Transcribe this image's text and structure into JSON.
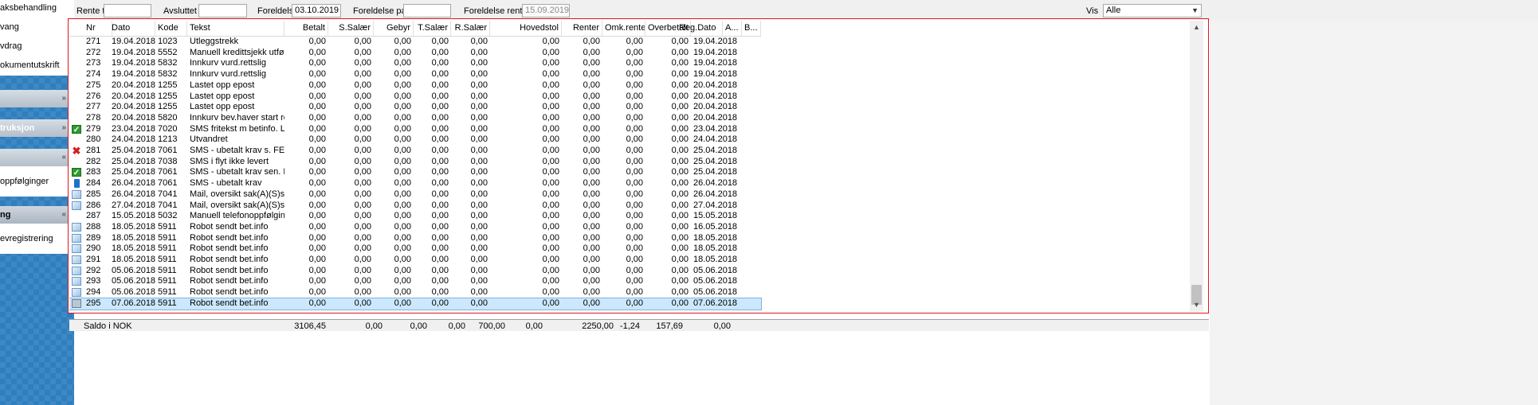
{
  "sidebar": {
    "links_top": [
      "aksbehandling",
      "vang",
      "vdrag",
      "okumentutskrift"
    ],
    "sections": [
      {
        "label": "",
        "chevron": "»"
      },
      {
        "label": "truksjon",
        "chevron": "»"
      },
      {
        "label": "",
        "chevron": "«"
      }
    ],
    "links_mid": [
      "oppfølginger"
    ],
    "section_last": {
      "label": "ng",
      "chevron": "«"
    },
    "links_bottom": [
      "evregistrering"
    ]
  },
  "filters": {
    "rente_til_label": "Rente til",
    "rente_til_value": "",
    "avsluttet_label": "Avsluttet",
    "avsluttet_value": "",
    "foreldelse_label": "Foreldelse",
    "foreldelse_value": "03.10.2019",
    "foreldelse_pant_label": "Foreldelse pant",
    "foreldelse_pant_value": "",
    "foreldelse_renter_label": "Foreldelse renter",
    "foreldelse_renter_value": "15.09.2019",
    "vis_label": "Vis",
    "vis_value": "Alle"
  },
  "grid": {
    "columns": [
      "Nr",
      "Dato",
      "Kode",
      "Tekst",
      "Betalt",
      "S.Salær",
      "Gebyr",
      "T.Salær",
      "R.Salær",
      "Hovedstol",
      "Renter",
      "Omk.rente",
      "Overbetalt",
      "Reg.Dato",
      "A...",
      "B..."
    ],
    "rows": [
      {
        "icon": "",
        "nr": "271",
        "dato": "19.04.2018",
        "kode": "1023",
        "tekst": "Utleggstrekk",
        "reg": "19.04.2018"
      },
      {
        "icon": "",
        "nr": "272",
        "dato": "19.04.2018",
        "kode": "5552",
        "tekst": "Manuell kredittsjekk utført",
        "reg": "19.04.2018"
      },
      {
        "icon": "",
        "nr": "273",
        "dato": "19.04.2018",
        "kode": "5832",
        "tekst": "Innkurv vurd.rettslig",
        "reg": "19.04.2018"
      },
      {
        "icon": "",
        "nr": "274",
        "dato": "19.04.2018",
        "kode": "5832",
        "tekst": "Innkurv vurd.rettslig",
        "reg": "19.04.2018"
      },
      {
        "icon": "",
        "nr": "275",
        "dato": "20.04.2018",
        "kode": "1255",
        "tekst": "Lastet opp epost",
        "reg": "20.04.2018"
      },
      {
        "icon": "",
        "nr": "276",
        "dato": "20.04.2018",
        "kode": "1255",
        "tekst": "Lastet opp epost",
        "reg": "20.04.2018"
      },
      {
        "icon": "",
        "nr": "277",
        "dato": "20.04.2018",
        "kode": "1255",
        "tekst": "Lastet opp epost",
        "reg": "20.04.2018"
      },
      {
        "icon": "",
        "nr": "278",
        "dato": "20.04.2018",
        "kode": "5820",
        "tekst": "Innkurv bev.haver start rettsl",
        "reg": "20.04.2018"
      },
      {
        "icon": "check",
        "nr": "279",
        "dato": "23.04.2018",
        "kode": "7020",
        "tekst": "SMS fritekst m betinfo. LE...",
        "reg": "23.04.2018"
      },
      {
        "icon": "",
        "nr": "280",
        "dato": "24.04.2018",
        "kode": "1213",
        "tekst": "Utvandret",
        "reg": "24.04.2018"
      },
      {
        "icon": "x",
        "nr": "281",
        "dato": "25.04.2018",
        "kode": "7061",
        "tekst": "SMS - ubetalt krav s. FEIL...",
        "reg": "25.04.2018"
      },
      {
        "icon": "",
        "nr": "282",
        "dato": "25.04.2018",
        "kode": "7038",
        "tekst": "SMS i flyt ikke levert",
        "reg": "25.04.2018"
      },
      {
        "icon": "check",
        "nr": "283",
        "dato": "25.04.2018",
        "kode": "7061",
        "tekst": "SMS - ubetalt krav sen. LE...",
        "reg": "25.04.2018"
      },
      {
        "icon": "phone",
        "nr": "284",
        "dato": "26.04.2018",
        "kode": "7061",
        "tekst": "SMS - ubetalt krav",
        "reg": "26.04.2018"
      },
      {
        "icon": "mail",
        "nr": "285",
        "dato": "26.04.2018",
        "kode": "7041",
        "tekst": "Mail, oversikt sak(A)(S)sendt",
        "reg": "26.04.2018"
      },
      {
        "icon": "mail",
        "nr": "286",
        "dato": "27.04.2018",
        "kode": "7041",
        "tekst": "Mail, oversikt sak(A)(S)sendt",
        "reg": "27.04.2018"
      },
      {
        "icon": "",
        "nr": "287",
        "dato": "15.05.2018",
        "kode": "5032",
        "tekst": "Manuell telefonoppfølging",
        "reg": "15.05.2018"
      },
      {
        "icon": "mail",
        "nr": "288",
        "dato": "18.05.2018",
        "kode": "5911",
        "tekst": "Robot sendt bet.info",
        "reg": "16.05.2018"
      },
      {
        "icon": "mail",
        "nr": "289",
        "dato": "18.05.2018",
        "kode": "5911",
        "tekst": "Robot sendt bet.info",
        "reg": "18.05.2018"
      },
      {
        "icon": "mail",
        "nr": "290",
        "dato": "18.05.2018",
        "kode": "5911",
        "tekst": "Robot sendt bet.info",
        "reg": "18.05.2018"
      },
      {
        "icon": "mail",
        "nr": "291",
        "dato": "18.05.2018",
        "kode": "5911",
        "tekst": "Robot sendt bet.info",
        "reg": "18.05.2018"
      },
      {
        "icon": "mail",
        "nr": "292",
        "dato": "05.06.2018",
        "kode": "5911",
        "tekst": "Robot sendt bet.info",
        "reg": "05.06.2018"
      },
      {
        "icon": "mail",
        "nr": "293",
        "dato": "05.06.2018",
        "kode": "5911",
        "tekst": "Robot sendt bet.info",
        "reg": "05.06.2018"
      },
      {
        "icon": "mail",
        "nr": "294",
        "dato": "05.06.2018",
        "kode": "5911",
        "tekst": "Robot sendt bet.info",
        "reg": "05.06.2018"
      },
      {
        "icon": "print",
        "nr": "295",
        "dato": "07.06.2018",
        "kode": "5911",
        "tekst": "Robot sendt bet.info",
        "reg": "07.06.2018",
        "selected": true
      }
    ],
    "zero": "0,00"
  },
  "footer": {
    "label": "Saldo i NOK",
    "values": [
      "3106,45",
      "0,00",
      "0,00",
      "0,00",
      "700,00",
      "0,00",
      "2250,00",
      "-1,24",
      "157,69",
      "0,00"
    ]
  },
  "colors": {
    "frame": "#e0151b",
    "sidebar": "#2f7fbf",
    "selected": "#cce8ff"
  }
}
